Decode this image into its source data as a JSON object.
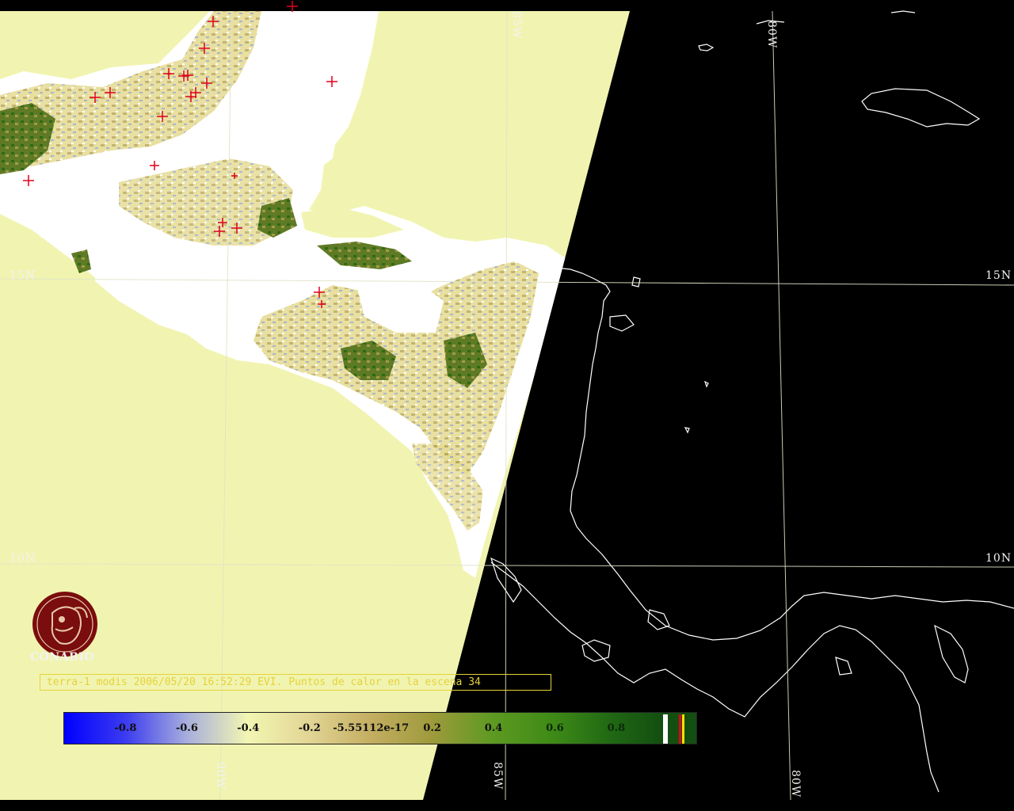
{
  "map": {
    "caption": "terra-1 modis 2006/05/20 16:52:29 EVI. Puntos de calor en la escena 34",
    "logo_text": "CONABIO",
    "grid_labels": {
      "lat_15_left": "15N",
      "lat_15_right": "15N",
      "lat_10_left": "10N",
      "lat_10_right": "10N",
      "lon_85_top": "85W",
      "lon_80_top": "80W",
      "lon_90_bottom": "90W",
      "lon_85_bottom": "85W",
      "lon_80_bottom": "80W"
    },
    "colors": {
      "background": "#000000",
      "swath_fill": "#f1f4b0",
      "cloud": "#ffffff",
      "coastline": "#ffffff",
      "graticule": "#dfe3c8",
      "hotspot": "#e0001a",
      "caption": "#e6d23a",
      "logo": "#7a0d0d"
    }
  },
  "colorbar": {
    "ticks": [
      {
        "label": "-0.8",
        "value": -0.8
      },
      {
        "label": "-0.6",
        "value": -0.6
      },
      {
        "label": "-0.4",
        "value": -0.4
      },
      {
        "label": "-0.2",
        "value": -0.2
      },
      {
        "label": "-5.55112e-17",
        "value": 0.0
      },
      {
        "label": "0.2",
        "value": 0.2
      },
      {
        "label": "0.4",
        "value": 0.4
      },
      {
        "label": "0.6",
        "value": 0.6
      },
      {
        "label": "0.8",
        "value": 0.8
      }
    ],
    "stops": [
      {
        "value": -1.0,
        "color": "#0000ff"
      },
      {
        "value": -0.8,
        "color": "#3b3bf0"
      },
      {
        "value": -0.6,
        "color": "#a7aedc"
      },
      {
        "value": -0.4,
        "color": "#f2f6b2"
      },
      {
        "value": -0.2,
        "color": "#e2d595"
      },
      {
        "value": 0.0,
        "color": "#c4ae62"
      },
      {
        "value": 0.2,
        "color": "#9f9a3c"
      },
      {
        "value": 0.4,
        "color": "#5d9a22"
      },
      {
        "value": 0.6,
        "color": "#3e8a16"
      },
      {
        "value": 0.8,
        "color": "#1f6614"
      },
      {
        "value": 0.95,
        "color": "#134f10"
      }
    ],
    "end_flags": [
      {
        "name": "white",
        "color": "#ffffff"
      },
      {
        "name": "red",
        "color": "#e0001a"
      },
      {
        "name": "yellow",
        "color": "#ffe000"
      }
    ]
  }
}
